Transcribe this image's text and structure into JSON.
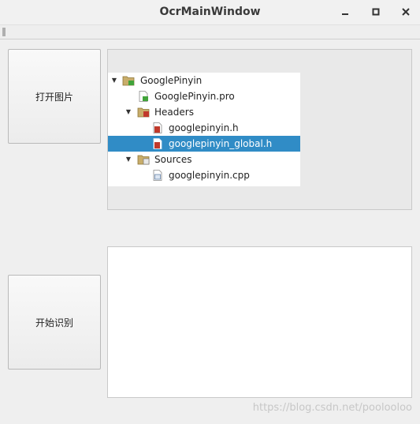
{
  "window": {
    "title": "OcrMainWindow",
    "minimize_glyph": "—",
    "maximize_glyph": "□",
    "close_glyph": "✕"
  },
  "buttons": {
    "open_image": "打开图片",
    "start_recognition": "开始识别"
  },
  "tree": {
    "items": [
      {
        "label": "GooglePinyin",
        "icon": "folder-qt-icon",
        "expanded": true
      },
      {
        "label": "GooglePinyin.pro",
        "icon": "qt-project-file-icon"
      },
      {
        "label": "Headers",
        "icon": "folder-header-icon",
        "expanded": true
      },
      {
        "label": "googlepinyin.h",
        "icon": "header-file-icon"
      },
      {
        "label": "googlepinyin_global.h",
        "icon": "header-file-icon",
        "selected": true
      },
      {
        "label": "Sources",
        "icon": "folder-source-icon",
        "expanded": true
      },
      {
        "label": "googlepinyin.cpp",
        "icon": "cpp-file-icon"
      }
    ]
  },
  "watermark": "https://blog.csdn.net/poolooloo",
  "colors": {
    "selection": "#308cc6",
    "folder": "#c8ad6a",
    "header_badge": "#c0392b",
    "qt_badge": "#41a33a"
  }
}
